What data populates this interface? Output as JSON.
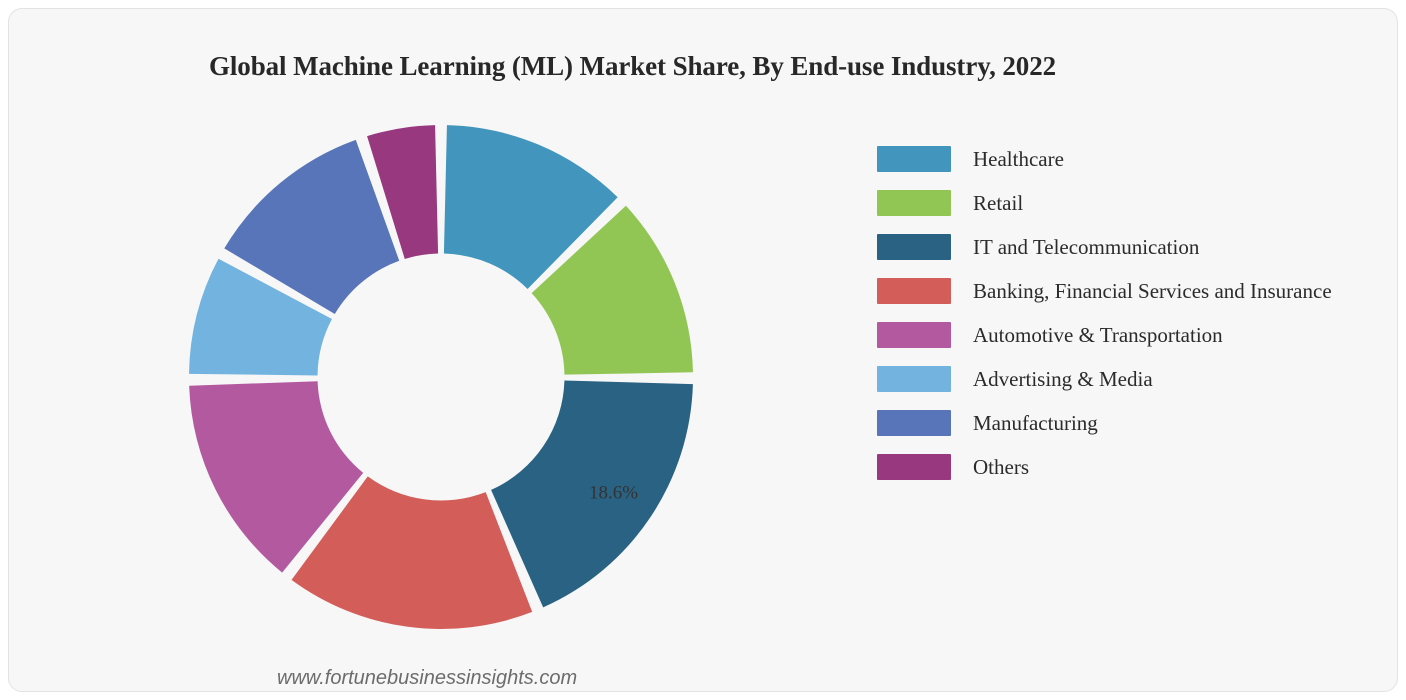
{
  "title": "Global Machine Learning (ML) Market Share, By End-use Industry, 2022",
  "watermark": "www.fortunebusinessinsights.com",
  "legend": {
    "items": [
      {
        "label": "Healthcare",
        "color": "#4295bd"
      },
      {
        "label": "Retail",
        "color": "#91c554"
      },
      {
        "label": "IT and Telecommunication",
        "color": "#2a6283"
      },
      {
        "label": "Banking, Financial Services and Insurance",
        "color": "#d35d58"
      },
      {
        "label": "Automotive & Transportation",
        "color": "#b359a0"
      },
      {
        "label": "Advertising & Media",
        "color": "#72b3e0"
      },
      {
        "label": "Manufacturing",
        "color": "#5775b8"
      },
      {
        "label": "Others",
        "color": "#98397f"
      }
    ]
  },
  "chart_data": {
    "type": "pie",
    "variant": "donut",
    "title": "Global Machine Learning (ML) Market Share, By End-use Industry, 2022",
    "unit": "percent",
    "start_angle_deg": 0,
    "direction": "clockwise",
    "inner_radius_ratio": 0.49,
    "legend_position": "right",
    "categories": [
      "Healthcare",
      "Retail",
      "IT and Telecommunication",
      "Banking, Financial Services and Insurance",
      "Automotive & Transportation",
      "Advertising & Media",
      "Manufacturing",
      "Others"
    ],
    "values": [
      12.7,
      12.3,
      18.6,
      16.7,
      14.3,
      8.3,
      11.7,
      5.1
    ],
    "colors": [
      "#4295bd",
      "#91c554",
      "#2a6283",
      "#d35d58",
      "#b359a0",
      "#72b3e0",
      "#5775b8",
      "#98397f"
    ],
    "visible_labels": [
      {
        "category": "IT and Telecommunication",
        "text": "18.6%",
        "value": 18.6
      }
    ]
  }
}
